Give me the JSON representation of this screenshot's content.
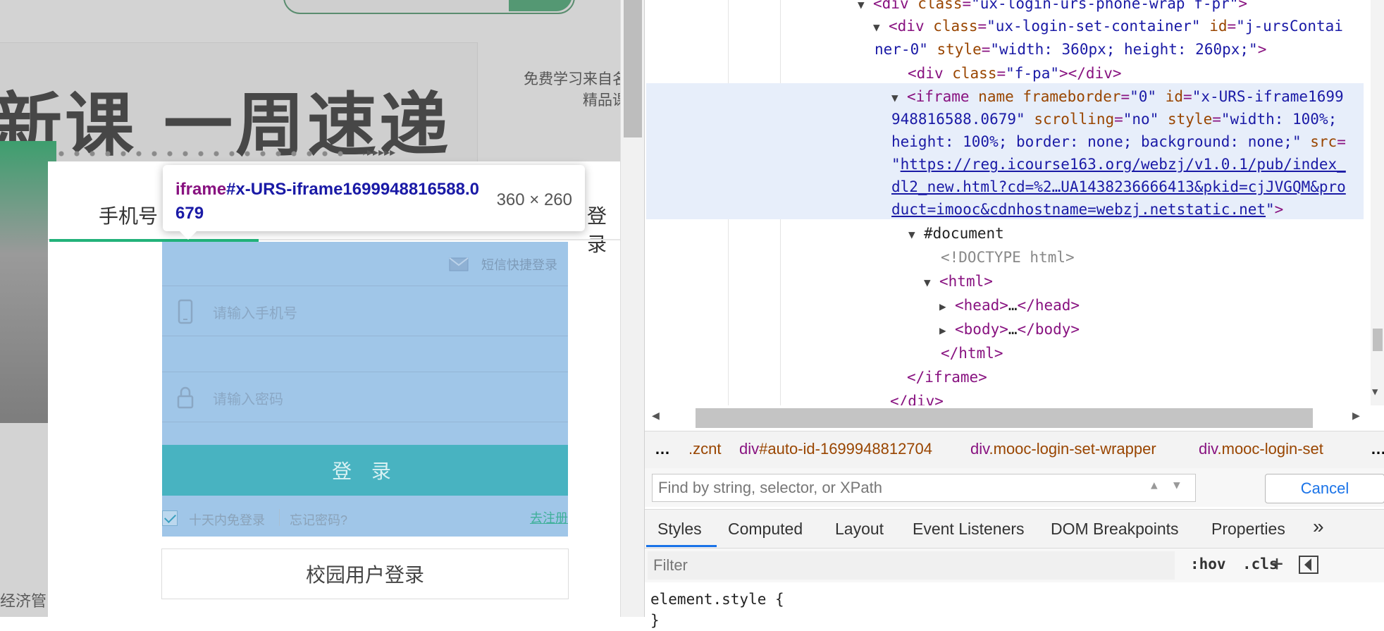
{
  "background": {
    "title": "新课 一周速递",
    "side_text_line1": "免费学习来自名",
    "side_text_line2": "精品课",
    "footer_text": "经济管"
  },
  "login": {
    "tab_phone": "手机号",
    "tab_other": "登录",
    "sms_quick_login": "短信快捷登录",
    "phone_placeholder": "请输入手机号",
    "password_placeholder": "请输入密码",
    "login_button": "登 录",
    "remember": "十天内免登录",
    "forgot": "忘记密码?",
    "register": "去注册",
    "campus_login": "校园用户登录"
  },
  "tooltip": {
    "tag": "iframe",
    "id": "#x-URS-iframe1699948816588.0679",
    "size": "360 × 260"
  },
  "devtools": {
    "elements": {
      "l0": {
        "tag": "div",
        "attr_class": "class",
        "val_class": "\"ux-login-urs-phone-wrap f-pr\""
      },
      "l1": {
        "tag": "div",
        "attr_class": "class",
        "val_class": "\"ux-login-set-container\"",
        "attr_id": "id",
        "val_id_a": "\"j-ursContai",
        "val_id_b": "ner-0\"",
        "attr_style": "style",
        "val_style": "\"width: 360px; height: 260px;\""
      },
      "l2": {
        "tag": "div",
        "attr_class": "class",
        "val_class": "\"f-pa\""
      },
      "l3": {
        "tag": "iframe",
        "attr_name": "name",
        "attr_fb": "frameborder",
        "val_fb": "\"0\"",
        "attr_id": "id",
        "val_id_a": "\"x-URS-iframe1699",
        "val_id_b": "948816588.0679\"",
        "attr_scroll": "scrolling",
        "val_scroll": "\"no\"",
        "attr_style": "style",
        "val_style_a": "\"width: 100%;",
        "val_style_b": "height: 100%; border: none; background: none;\"",
        "attr_src": "src",
        "link_a": "https://reg.icourse163.org/webzj/v1.0.1/pub/index_",
        "link_b": "dl2_new.html?cd=%2…UA1438236666413&pkid=cjJVGQM&pro",
        "link_c": "duct=imooc&cdnhostname=webzj.netstatic.net"
      },
      "l4": "#document",
      "l5": "<!DOCTYPE html>",
      "l6": "html",
      "l7": "head",
      "l8": "body",
      "l9": "html",
      "l10": "iframe",
      "l11": "div",
      "ellipsis": "…"
    },
    "breadcrumbs": [
      {
        "text": "…"
      },
      {
        "text": ".zcnt"
      },
      {
        "tag": "div",
        "rest": "#auto-id-1699948812704"
      },
      {
        "tag": "div",
        "rest": ".mooc-login-set-wrapper"
      },
      {
        "tag": "div",
        "rest": ".mooc-login-set"
      },
      {
        "text": "…"
      }
    ],
    "find_placeholder": "Find by string, selector, or XPath",
    "cancel": "Cancel",
    "tabs": [
      "Styles",
      "Computed",
      "Layout",
      "Event Listeners",
      "DOM Breakpoints",
      "Properties",
      "»"
    ],
    "filter_placeholder": "Filter",
    "hov": ":hov",
    "cls": ".cls",
    "plus": "+",
    "style_rule": "element.style {",
    "style_rule_end": "}",
    "accent_color": "#1a73e8"
  }
}
